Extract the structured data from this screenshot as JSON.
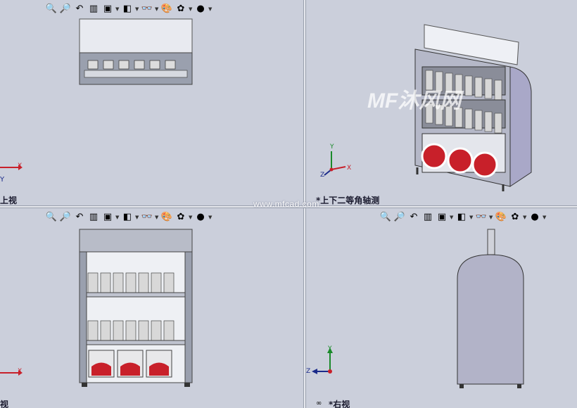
{
  "toolbar": {
    "icons": [
      "zoom-fit-icon",
      "zoom-area-icon",
      "previous-view-icon",
      "section-view-icon",
      "view-orientation-icon",
      "display-style-icon",
      "hide-show-icon",
      "edit-appearance-icon",
      "apply-scene-icon",
      "view-settings-icon"
    ]
  },
  "viewports": {
    "top_left": {
      "label": "上视"
    },
    "top_right": {
      "label": "*上下二等角轴测"
    },
    "bottom_left": {
      "label": "前视"
    },
    "bottom_right": {
      "label": "*右视"
    }
  },
  "axes": {
    "x": "X",
    "y": "Y",
    "z": "Z"
  },
  "watermark": {
    "site": "www.mfcad.com",
    "logo": "MF沐风网"
  },
  "colors": {
    "background": "#cbcfdb",
    "accent_red": "#c8202a",
    "bottle": "#d8d8d8",
    "frame": "#8a8d99"
  }
}
